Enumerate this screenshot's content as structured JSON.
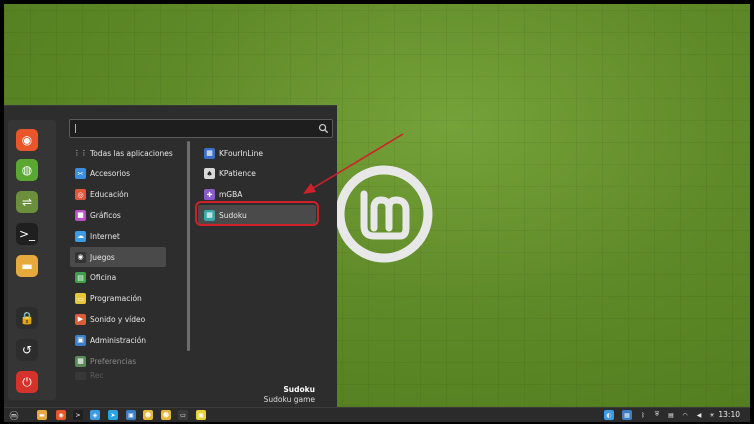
{
  "search": {
    "value": "|",
    "placeholder": ""
  },
  "favorites": [
    {
      "name": "firefox-icon",
      "color": "#e8562a",
      "glyph": "◉"
    },
    {
      "name": "chromium-icon",
      "color": "#5aa832",
      "glyph": "◍"
    },
    {
      "name": "settings-toggle-icon",
      "color": "#6b8f3a",
      "glyph": "⇌"
    },
    {
      "name": "terminal-icon",
      "color": "#1f1f1f",
      "glyph": ">_"
    },
    {
      "name": "folder-icon",
      "color": "#e6a93b",
      "glyph": "▬"
    },
    {
      "name": "lock-icon",
      "color": "#2d2d2d",
      "glyph": "🔒"
    },
    {
      "name": "logout-icon",
      "color": "#2d2d2d",
      "glyph": "↺"
    },
    {
      "name": "power-icon",
      "color": "#d6322c",
      "glyph": "⏻"
    }
  ],
  "categories": [
    {
      "label": "Todas las aplicaciones",
      "icon": "grid-icon",
      "color": "#2d2d2d",
      "glyph": "⋮⋮"
    },
    {
      "label": "Accesorios",
      "icon": "accessories-icon",
      "color": "#3a8ee6",
      "glyph": "✂"
    },
    {
      "label": "Educación",
      "icon": "education-icon",
      "color": "#e0573a",
      "glyph": "◎"
    },
    {
      "label": "Gráficos",
      "icon": "graphics-icon",
      "color": "#c050c8",
      "glyph": "■"
    },
    {
      "label": "Internet",
      "icon": "internet-icon",
      "color": "#3a9be6",
      "glyph": "☁"
    },
    {
      "label": "Juegos",
      "icon": "games-icon",
      "color": "#333333",
      "glyph": "◉"
    },
    {
      "label": "Oficina",
      "icon": "office-icon",
      "color": "#3fa04a",
      "glyph": "▤"
    },
    {
      "label": "Programación",
      "icon": "programming-icon",
      "color": "#e6c53a",
      "glyph": "▭"
    },
    {
      "label": "Sonido y vídeo",
      "icon": "sound-video-icon",
      "color": "#e05a3a",
      "glyph": "▶"
    },
    {
      "label": "Administración",
      "icon": "administration-icon",
      "color": "#3a7fc8",
      "glyph": "▣"
    },
    {
      "label": "Preferencias",
      "icon": "preferences-icon",
      "color": "#5a8a5a",
      "glyph": "▦"
    },
    {
      "label": "Rec",
      "icon": "recent-icon",
      "color": "#444444",
      "glyph": ""
    }
  ],
  "selected_category": "Juegos",
  "apps": [
    {
      "label": "KFourInLine",
      "icon": "kfourinline-icon",
      "color": "#3a6fc8",
      "glyph": "▦"
    },
    {
      "label": "KPatience",
      "icon": "kpatience-icon",
      "color": "#d8d8d8",
      "glyph": "♠"
    },
    {
      "label": "mGBA",
      "icon": "mgba-icon",
      "color": "#8a5ac8",
      "glyph": "✚"
    },
    {
      "label": "Sudoku",
      "icon": "sudoku-icon",
      "color": "#3aa8a8",
      "glyph": "▦"
    }
  ],
  "selected_app": "Sudoku",
  "footer": {
    "app_title": "Sudoku",
    "app_description": "Sudoku game"
  },
  "taskbar": {
    "clock": "13:10",
    "launchers": [
      {
        "name": "menu-logo-icon",
        "color": "#2b2b2b",
        "glyph": "ⓜ"
      },
      {
        "name": "files-icon",
        "color": "#e6a93b",
        "glyph": "▬"
      },
      {
        "name": "firefox-taskbar-icon",
        "color": "#e8562a",
        "glyph": "◉"
      },
      {
        "name": "terminal-taskbar-icon",
        "color": "#1f1f1f",
        "glyph": ">"
      },
      {
        "name": "app-taskbar-icon-1",
        "color": "#3a9be6",
        "glyph": "◈"
      },
      {
        "name": "telegram-icon",
        "color": "#2aa3e0",
        "glyph": "➤"
      },
      {
        "name": "app-taskbar-icon-2",
        "color": "#3a7fc8",
        "glyph": "▣"
      },
      {
        "name": "app-taskbar-icon-3",
        "color": "#e6b83a",
        "glyph": "☻"
      },
      {
        "name": "app-taskbar-icon-4",
        "color": "#e6b83a",
        "glyph": "☻"
      },
      {
        "name": "monitor-icon",
        "color": "#3a3a3a",
        "glyph": "▭"
      },
      {
        "name": "app-taskbar-icon-5",
        "color": "#e6d43a",
        "glyph": "▣"
      }
    ],
    "tray": [
      {
        "name": "tray-app-icon",
        "color": "#3a9be6",
        "glyph": "◐"
      },
      {
        "name": "tray-update-icon",
        "color": "#3a7fc8",
        "glyph": "▦"
      },
      {
        "name": "bluetooth-icon",
        "color": "#2b2b2b",
        "glyph": "ᛒ"
      },
      {
        "name": "shield-icon",
        "color": "#2b2b2b",
        "glyph": "⛨"
      },
      {
        "name": "clipboard-icon",
        "color": "#2b2b2b",
        "glyph": "▤"
      },
      {
        "name": "wifi-icon",
        "color": "#2b2b2b",
        "glyph": "◠"
      },
      {
        "name": "volume-icon",
        "color": "#2b2b2b",
        "glyph": "◀"
      },
      {
        "name": "brightness-icon",
        "color": "#2b2b2b",
        "glyph": "☀"
      }
    ]
  }
}
